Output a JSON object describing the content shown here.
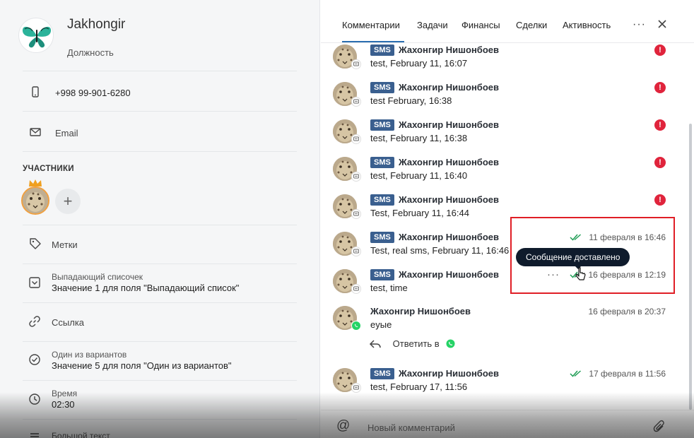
{
  "contact": {
    "name": "Jakhongir",
    "position": "Должность",
    "phone": "+998 99-901-6280",
    "email_label": "Email"
  },
  "participants": {
    "title": "УЧАСТНИКИ",
    "add_symbol": "+"
  },
  "fields": {
    "tags": "Метки",
    "dropdown_label": "Выпадающий списочек",
    "dropdown_value": "Значение 1 для поля \"Выпадающий список\"",
    "link": "Ссылка",
    "radio_label": "Один из вариантов",
    "radio_value": "Значение 5 для поля \"Один из вариантов\"",
    "time_label": "Время",
    "time_value": "02:30",
    "bigtext_label": "Большой текст"
  },
  "tabs": [
    "Комментарии",
    "Задачи",
    "Финансы",
    "Сделки",
    "Активность"
  ],
  "messages": [
    {
      "channel": "SMS",
      "author": "Жахонгир Нишонбоев",
      "text": "test, February 11, 16:07",
      "status": "error",
      "time": ""
    },
    {
      "channel": "SMS",
      "author": "Жахонгир Нишонбоев",
      "text": "test February, 16:38",
      "status": "error",
      "time": ""
    },
    {
      "channel": "SMS",
      "author": "Жахонгир Нишонбоев",
      "text": "test, February 11, 16:38",
      "status": "error",
      "time": ""
    },
    {
      "channel": "SMS",
      "author": "Жахонгир Нишонбоев",
      "text": "test, February 11, 16:40",
      "status": "error",
      "time": ""
    },
    {
      "channel": "SMS",
      "author": "Жахонгир Нишонбоев",
      "text": "Test, February 11, 16:44",
      "status": "error",
      "time": ""
    },
    {
      "channel": "SMS",
      "author": "Жахонгир Нишонбоев",
      "text": "Test, real sms, February 11, 16:46",
      "status": "delivered",
      "time": "11 февраля в 16:46"
    },
    {
      "channel": "SMS",
      "author": "Жахонгир Нишонбоев",
      "text": "test, time",
      "status": "delivered",
      "time": "16 февраля в 12:19"
    },
    {
      "channel": "WhatsApp",
      "author": "Жахонгир Нишонбоев",
      "text": "eyыe",
      "status": "",
      "time": "16 февраля в 20:37"
    },
    {
      "channel": "SMS",
      "author": "Жахонгир Нишонбоев",
      "text": "test, February 17, 11:56",
      "status": "delivered",
      "time": "17 февраля в 11:56"
    }
  ],
  "reply_label": "Ответить в",
  "tooltip": "Сообщение доставлено",
  "composer_placeholder": "Новый комментарий",
  "colors": {
    "accent": "#2a6db0",
    "sms_tag": "#3a5f8f",
    "error": "#e0243c",
    "delivered": "#1f9d55",
    "whatsapp": "#25d366",
    "highlight": "#e01e26"
  }
}
